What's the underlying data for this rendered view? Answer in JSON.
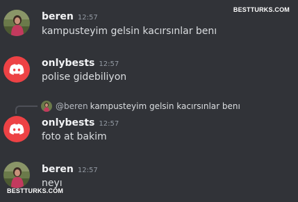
{
  "watermark": "BESTTURKS.COM",
  "messages": [
    {
      "author": "beren",
      "time": "12:57",
      "content": "kampusteyim gelsin kacırsınlar benı"
    },
    {
      "author": "onlybests",
      "time": "12:57",
      "content": "polise gidebiliyon"
    },
    {
      "reply": {
        "author": "@beren",
        "content": "kampusteyim gelsin kacırsınlar benı"
      },
      "author": "onlybests",
      "time": "12:57",
      "content": "foto at bakim"
    },
    {
      "author": "beren",
      "time": "12:57",
      "content": "neyı"
    }
  ],
  "colors": {
    "background": "#313338",
    "discord_red": "#ed4245",
    "author": "#f2f3f5",
    "timestamp": "#949ba4",
    "text": "#dbdee1"
  },
  "icons": {
    "beren_avatar": "photo-avatar",
    "onlybests_avatar": "discord-logo-icon"
  }
}
